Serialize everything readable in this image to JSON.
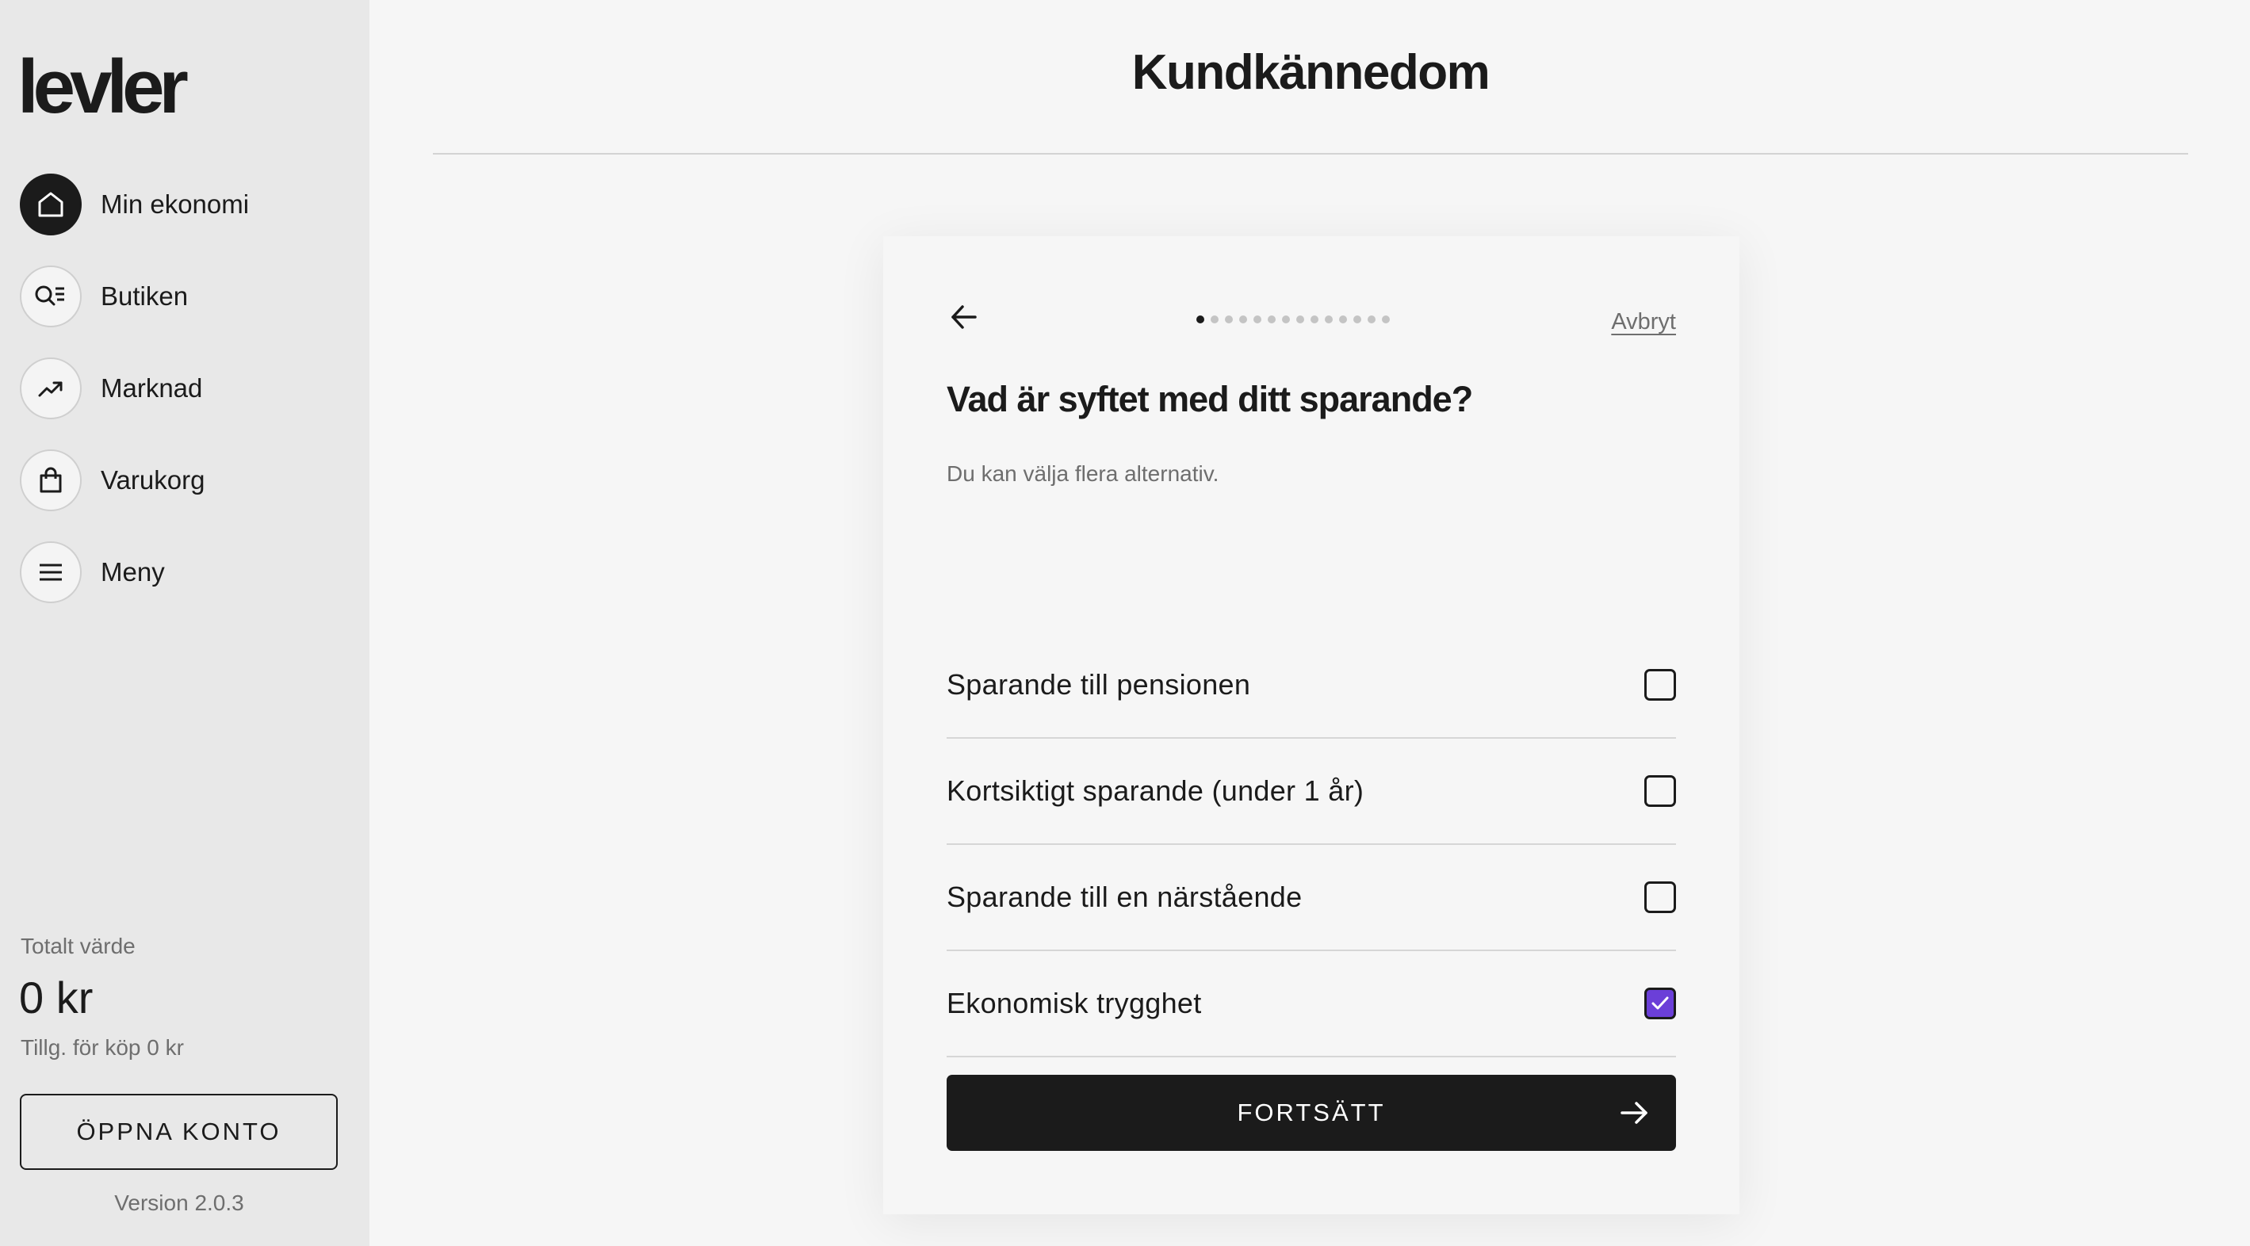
{
  "sidebar": {
    "logo": "levler",
    "nav": [
      {
        "label": "Min ekonomi",
        "icon": "home-icon",
        "active": true
      },
      {
        "label": "Butiken",
        "icon": "search-list-icon",
        "active": false
      },
      {
        "label": "Marknad",
        "icon": "trending-up-icon",
        "active": false
      },
      {
        "label": "Varukorg",
        "icon": "shopping-bag-icon",
        "active": false
      },
      {
        "label": "Meny",
        "icon": "menu-icon",
        "active": false
      }
    ],
    "total_label": "Totalt värde",
    "total_value": "0 kr",
    "available": "Tillg. för köp 0 kr",
    "open_account": "ÖPPNA KONTO",
    "version": "Version 2.0.3"
  },
  "header": {
    "title": "Kundkännedom"
  },
  "card": {
    "cancel": "Avbryt",
    "progress": {
      "current_step": 1,
      "total_steps": 14
    },
    "question": "Vad är syftet med ditt sparande?",
    "hint": "Du kan välja flera alternativ.",
    "options": [
      {
        "label": "Sparande till pensionen",
        "checked": false
      },
      {
        "label": "Kortsiktigt sparande (under 1 år)",
        "checked": false
      },
      {
        "label": "Sparande till en närstående",
        "checked": false
      },
      {
        "label": "Ekonomisk trygghet",
        "checked": true
      }
    ],
    "continue": "FORTSÄTT"
  },
  "colors": {
    "accent": "#6b3fd8",
    "dark": "#1b1b1b",
    "sidebar_bg": "#e8e8e8",
    "page_bg": "#f6f6f6"
  }
}
